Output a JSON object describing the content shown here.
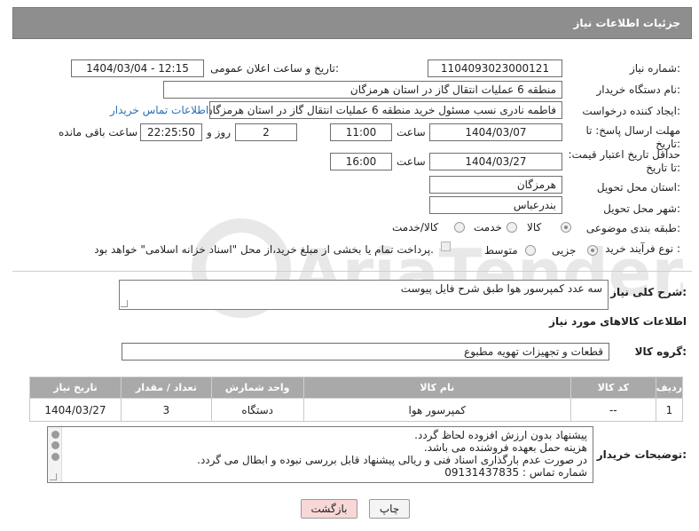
{
  "header": {
    "title": "جزئیات اطلاعات نیاز"
  },
  "form": {
    "need_number_label": "شماره نیاز:",
    "need_number": "1104093023000121",
    "announce_label": "تاریخ و ساعت اعلان عمومی:",
    "announce_value": "1404/03/04 - 12:15",
    "buyer_org_label": "نام دستگاه خریدار:",
    "buyer_org": "منطقه 6 عملیات انتقال گاز در استان هرمزگان",
    "creator_label": "ایجاد کننده درخواست:",
    "creator": "فاطمه نادری نسب مسئول خرید منطقه 6 عملیات انتقال گاز در استان هرمزگان",
    "buyer_contact_link": "اطلاعات تماس خریدار",
    "deadline_label": "مهلت ارسال پاسخ: تا تاریخ:",
    "deadline_date": "1404/03/07",
    "time_label": "ساعت",
    "deadline_time": "11:00",
    "days_value": "2",
    "days_label": "روز و",
    "remaining_value": "22:25:50",
    "remaining_label": "ساعت باقی مانده",
    "validity_label": "حداقل تاریخ اعتبار قیمت: تا تاریخ:",
    "validity_date": "1404/03/27",
    "validity_time_label": "ساعت",
    "validity_time": "16:00",
    "province_label": "استان محل تحویل:",
    "province": "هرمزگان",
    "city_label": "شهر محل تحویل:",
    "city": "بندرعباس",
    "category_label": "طبقه بندی موضوعی:",
    "category_options": [
      "کالا",
      "خدمت",
      "کالا/خدمت"
    ],
    "category_selected": "کالا",
    "process_label": "نوع فرآیند خرید :",
    "process_options": [
      "جزیی",
      "متوسط"
    ],
    "process_selected": "جزیی",
    "payment_note": "پرداخت تمام یا بخشی از مبلغ خرید،از محل \"اسناد خزانه اسلامی\" خواهد بود."
  },
  "summary": {
    "label": "شرح کلی نیاز:",
    "text": "سه عدد کمپرسور هوا طبق شرح فایل پیوست"
  },
  "items_section": {
    "title": "اطلاعات کالاهای مورد نیاز",
    "group_label": "گروه کالا:",
    "group_value": "قطعات و تجهیزات تهویه مطبوع",
    "columns": [
      "ردیف",
      "کد کالا",
      "نام کالا",
      "واحد شمارش",
      "تعداد / مقدار",
      "تاریخ نیاز"
    ],
    "rows": [
      [
        "1",
        "--",
        "کمپرسور هوا",
        "دستگاه",
        "3",
        "1404/03/27"
      ]
    ]
  },
  "buyer_notes": {
    "label": "توضیحات خریدار:",
    "lines": [
      "پیشنهاد بدون ارزش افزوده لحاظ گردد.",
      "هزینه حمل بعهده فروشنده می باشد.",
      "در صورت عدم بارگذاری اسناد فنی و ریالی پیشنهاد قابل بررسی نبوده و ابطال می گردد.",
      "شماره تماس : 09131437835"
    ]
  },
  "buttons": {
    "print": "چاپ",
    "back": "بازگشت"
  },
  "watermark": {
    "text": "AriaTender.net"
  },
  "colors": {
    "header_bg": "#8e8e8e",
    "table_header_bg": "#a9a9a9",
    "link": "#2b6fb8",
    "back_button_bg": "#f8d7d7"
  }
}
